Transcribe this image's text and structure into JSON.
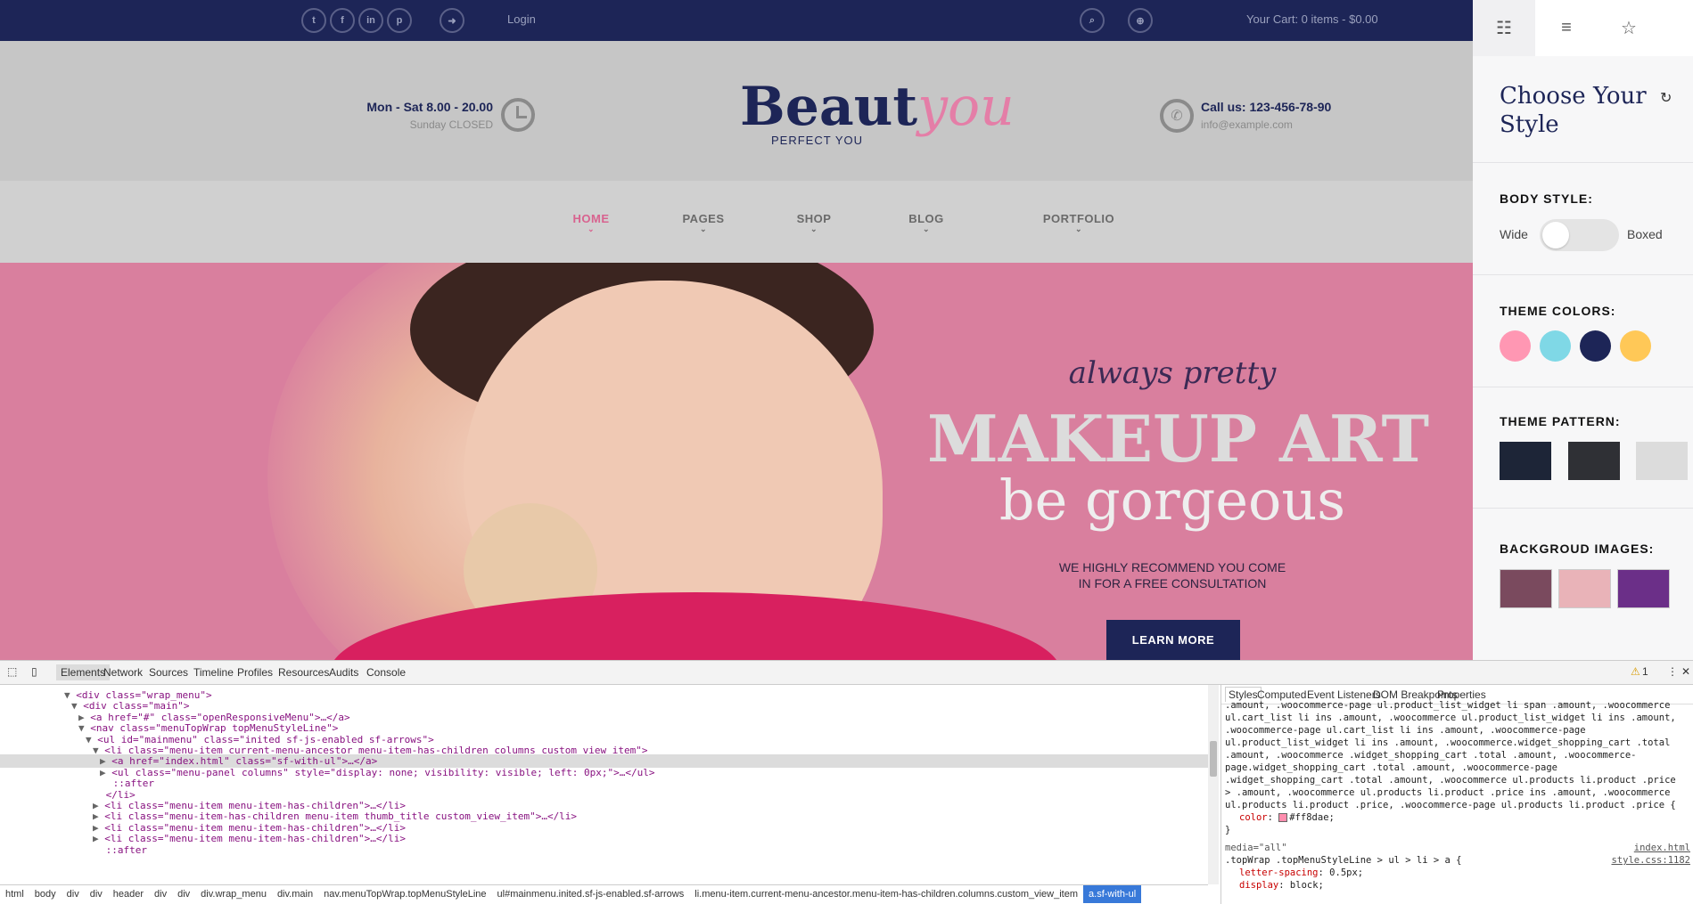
{
  "topbar": {
    "social": [
      {
        "icon": "twitter-icon",
        "glyph": "t"
      },
      {
        "icon": "facebook-icon",
        "glyph": "f"
      },
      {
        "icon": "linkedin-icon",
        "glyph": "in"
      },
      {
        "icon": "pinterest-icon",
        "glyph": "p"
      }
    ],
    "login_label": "Login",
    "cart_label": "Your Cart: 0 items - $0.00"
  },
  "header": {
    "hours_main": "Mon - Sat 8.00 - 20.00",
    "hours_sub": "Sunday CLOSED",
    "logo_part1": "Beaut",
    "logo_part2": "you",
    "tagline": "PERFECT YOU",
    "call": "Call us: 123-456-78-90",
    "email": "info@example.com"
  },
  "nav": {
    "items": [
      {
        "label": "HOME",
        "active": true
      },
      {
        "label": "PAGES"
      },
      {
        "label": "SHOP"
      },
      {
        "label": "BLOG"
      },
      {
        "label": "PORTFOLIO"
      }
    ]
  },
  "hero": {
    "script": "always pretty",
    "headline": "MAKEUP ART",
    "subheadline": "be gorgeous",
    "text_line1": "WE HIGHLY RECOMMEND YOU COME",
    "text_line2": "IN FOR A FREE CONSULTATION",
    "button": "LEARN MORE"
  },
  "panel": {
    "title_line1": "Choose Your",
    "title_line2": "Style",
    "body_style_label": "BODY STYLE:",
    "wide_label": "Wide",
    "boxed_label": "Boxed",
    "theme_colors_label": "THEME COLORS:",
    "theme_colors": [
      "#ff97b3",
      "#7fd8e6",
      "#1d2557",
      "#ffc857"
    ],
    "theme_pattern_label": "THEME PATTERN:",
    "patterns": [
      "#1d2537",
      "#2f3035",
      "#dcdcdc"
    ],
    "background_images_label": "BACKGROUD IMAGES:",
    "background_images": [
      "#7a4a5e",
      "#e9b3b8",
      "#6b2f88"
    ]
  },
  "devtools": {
    "tabs": [
      "Elements",
      "Network",
      "Sources",
      "Timeline",
      "Profiles",
      "Resources",
      "Audits",
      "Console"
    ],
    "warning_count": "1",
    "dom_lines": [
      {
        "indent": 9,
        "arrow": "▼",
        "tag": "<div class=\"wrap_menu\">"
      },
      {
        "indent": 10,
        "arrow": "▼",
        "tag": "<div class=\"main\">"
      },
      {
        "indent": 11,
        "arrow": "▶",
        "tag": "<a href=\"#\" class=\"openResponsiveMenu\">…</a>"
      },
      {
        "indent": 11,
        "arrow": "▼",
        "tag": "<nav class=\"menuTopWrap topMenuStyleLine\">"
      },
      {
        "indent": 12,
        "arrow": "▼",
        "tag": "<ul id=\"mainmenu\" class=\"inited sf-js-enabled sf-arrows\">"
      },
      {
        "indent": 13,
        "arrow": "▼",
        "tag": "<li class=\"menu-item current-menu-ancestor menu-item-has-children columns custom_view_item\">"
      },
      {
        "indent": 14,
        "arrow": "▶",
        "tag": "<a href=\"index.html\" class=\"sf-with-ul\">…</a>",
        "selected": true
      },
      {
        "indent": 14,
        "arrow": "▶",
        "tag": "<ul class=\"menu-panel columns\" style=\"display: none; visibility: visible; left: 0px;\">…</ul>"
      },
      {
        "indent": 15,
        "arrow": "",
        "tag": "::after"
      },
      {
        "indent": 14,
        "arrow": "",
        "tag": "</li>"
      },
      {
        "indent": 13,
        "arrow": "▶",
        "tag": "<li class=\"menu-item menu-item-has-children\">…</li>"
      },
      {
        "indent": 13,
        "arrow": "▶",
        "tag": "<li class=\"menu-item-has-children menu-item thumb_title custom_view_item\">…</li>"
      },
      {
        "indent": 13,
        "arrow": "▶",
        "tag": "<li class=\"menu-item menu-item-has-children\">…</li>"
      },
      {
        "indent": 13,
        "arrow": "▶",
        "tag": "<li class=\"menu-item menu-item-has-children\">…</li>"
      },
      {
        "indent": 14,
        "arrow": "",
        "tag": "::after"
      }
    ],
    "styles_tabs": [
      "Styles",
      "Computed",
      "Event Listeners",
      "DOM Breakpoints",
      "Properties"
    ],
    "styles_lines": [
      ".amount, .woocommerce-page ul.product_list_widget li span .amount, .woocommerce",
      "ul.cart_list li ins .amount, .woocommerce ul.product_list_widget li ins .amount,",
      ".woocommerce-page ul.cart_list li ins .amount, .woocommerce-page",
      "ul.product_list_widget li ins .amount, .woocommerce.widget_shopping_cart .total",
      ".amount, .woocommerce .widget_shopping_cart .total .amount, .woocommerce-",
      "page.widget_shopping_cart .total .amount, .woocommerce-page",
      ".widget_shopping_cart .total .amount, .woocommerce ul.products li.product .price",
      "> .amount, .woocommerce ul.products li.product .price ins .amount, .woocommerce",
      "ul.products li.product .price, .woocommerce-page ul.products li.product .price {"
    ],
    "color_prop": "color",
    "color_value": "#ff8dae;",
    "close_brace": "}",
    "media": "media=\"all\"",
    "source1": "index.html",
    "rule2": ".topWrap .topMenuStyleLine > ul > li > a {",
    "source2": "style.css:1182",
    "prop2": "letter-spacing",
    "val2": "0.5px;",
    "prop3": "display",
    "val3": "block;",
    "breadcrumbs": [
      "html",
      "body",
      "div",
      "div",
      "header",
      "div",
      "div",
      "div.wrap_menu",
      "div.main",
      "nav.menuTopWrap.topMenuStyleLine",
      "ul#mainmenu.inited.sf-js-enabled.sf-arrows",
      "li.menu-item.current-menu-ancestor.menu-item-has-children.columns.custom_view_item",
      "a.sf-with-ul"
    ]
  }
}
